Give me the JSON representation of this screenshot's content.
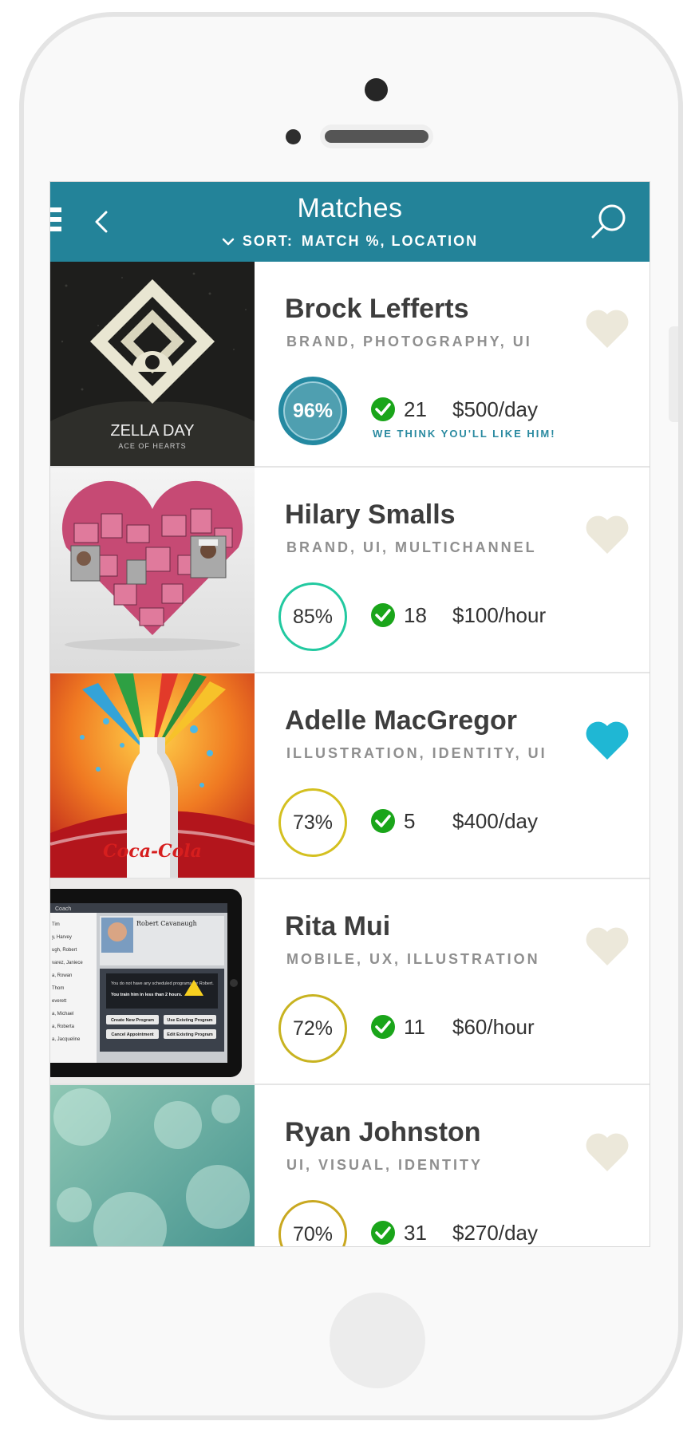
{
  "header": {
    "title": "Matches",
    "sort_label": "SORT:",
    "sort_value": "MATCH %, LOCATION"
  },
  "icons": {
    "menu": "hamburger-icon",
    "back": "chevron-left-icon",
    "search": "search-icon",
    "sort": "chevron-down-icon",
    "check": "check-circle-icon",
    "favorite": "heart-icon"
  },
  "colors": {
    "header_bg": "#238399",
    "heart_active": "#1fb7d4",
    "heart_inactive": "#ece8da",
    "check": "#1aa51a"
  },
  "matches": [
    {
      "name": "Brock Lefferts",
      "tags": "BRAND, PHOTOGRAPHY, UI",
      "match": "96%",
      "count": "21",
      "rate": "$500/day",
      "note": "WE THINK YOU'LL LIKE HIM!",
      "favorite": false,
      "ring_color": "#2489a1",
      "thumb": {
        "caption_title": "ZELLA DAY",
        "caption_sub": "ACE OF HEARTS"
      }
    },
    {
      "name": "Hilary Smalls",
      "tags": "BRAND, UI, MULTICHANNEL",
      "match": "85%",
      "count": "18",
      "rate": "$100/hour",
      "favorite": false,
      "ring_color": "#22c9a0"
    },
    {
      "name": "Adelle MacGregor",
      "tags": "ILLUSTRATION, IDENTITY, UI",
      "match": "73%",
      "count": "5",
      "rate": "$400/day",
      "favorite": true,
      "ring_color": "#d4c020",
      "thumb": {
        "logo": "Coca-Cola"
      }
    },
    {
      "name": "Rita Mui",
      "tags": "MOBILE, UX, ILLUSTRATION",
      "match": "72%",
      "count": "11",
      "rate": "$60/hour",
      "favorite": false,
      "ring_color": "#c8b320",
      "thumb": {
        "app_name": "Coach",
        "profile_name": "Robert Cavanaugh",
        "warning": "You do not have any scheduled programs for Robert.",
        "warning_bold": "You train him in less than 2 hours.",
        "buttons": [
          "Create New Program",
          "Use Existing Program",
          "Cancel Appointment",
          "Edit Existing Program"
        ],
        "list": [
          "Tim",
          "y, Harvey",
          "ugh, Robert",
          "varez, Janiece",
          "a, Rowan",
          "Thom",
          "everett",
          "a, Michael",
          "a, Roberta",
          "a, Jacqueline"
        ]
      }
    },
    {
      "name": "Ryan Johnston",
      "tags": "UI, VISUAL, IDENTITY",
      "match": "70%",
      "count": "31",
      "rate": "$270/day",
      "favorite": false,
      "ring_color": "#c9a820"
    }
  ]
}
